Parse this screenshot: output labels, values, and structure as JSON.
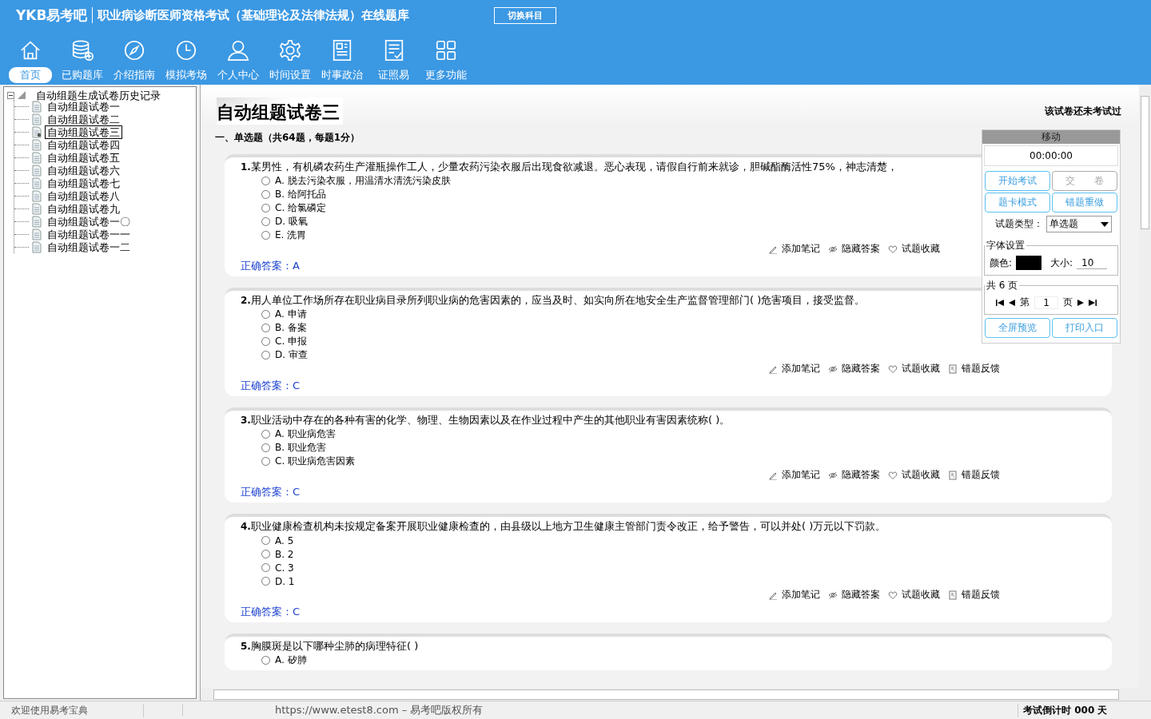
{
  "header": {
    "logo": "YKB易考吧",
    "title": "职业病诊断医师资格考试（基础理论及法律法规）在线题库",
    "switch_button": "切换科目"
  },
  "toolbar": [
    {
      "label": "首页",
      "selected": true
    },
    {
      "label": "已购题库",
      "selected": false
    },
    {
      "label": "介绍指南",
      "selected": false
    },
    {
      "label": "模拟考场",
      "selected": false
    },
    {
      "label": "个人中心",
      "selected": false
    },
    {
      "label": "时间设置",
      "selected": false
    },
    {
      "label": "时事政治",
      "selected": false
    },
    {
      "label": "证照易",
      "selected": false
    },
    {
      "label": "更多功能",
      "selected": false
    }
  ],
  "tree": {
    "label": "自动组题生成试卷历史记录",
    "expanded": true,
    "children": [
      {
        "label": "自动组题试卷一",
        "selected": false
      },
      {
        "label": "自动组题试卷二",
        "selected": false
      },
      {
        "label": "自动组题试卷三",
        "selected": true
      },
      {
        "label": "自动组题试卷四",
        "selected": false
      },
      {
        "label": "自动组题试卷五",
        "selected": false
      },
      {
        "label": "自动组题试卷六",
        "selected": false
      },
      {
        "label": "自动组题试卷七",
        "selected": false
      },
      {
        "label": "自动组题试卷八",
        "selected": false
      },
      {
        "label": "自动组题试卷九",
        "selected": false
      },
      {
        "label": "自动组题试卷一〇",
        "selected": false
      },
      {
        "label": "自动组题试卷一一",
        "selected": false
      },
      {
        "label": "自动组题试卷一二",
        "selected": false
      }
    ]
  },
  "paper": {
    "title": "自动组题试卷三",
    "status": "该试卷还未考试过",
    "section": "一、单选题（共64题，每题1分）"
  },
  "questions": [
    {
      "number": "1.",
      "text": "某男性，有机磷农药生产灌瓶操作工人，少量农药污染衣服后出现食欲减退。恶心表现，请假自行前来就诊，胆碱酯酶活性75%，神志清楚，",
      "options": [
        {
          "text": "A. 脱去污染衣服，用温清水清洗污染皮肤",
          "selected": false
        },
        {
          "text": "B. 给阿托品",
          "selected": false
        },
        {
          "text": "C. 给氯磷定",
          "selected": false
        },
        {
          "text": "D. 吸氧",
          "selected": false
        },
        {
          "text": "E. 洗胃",
          "selected": false
        }
      ],
      "actions": [
        "添加笔记",
        "隐藏答案",
        "试题收藏"
      ],
      "answer_label": "正确答案：",
      "answer": "A"
    },
    {
      "number": "2.",
      "text": "用人单位工作场所存在职业病目录所列职业病的危害因素的，应当及时、如实向所在地安全生产监督管理部门( )危害项目，接受监督。",
      "options": [
        {
          "text": "A. 申请",
          "selected": false
        },
        {
          "text": "B. 备案",
          "selected": false
        },
        {
          "text": "C. 申报",
          "selected": false
        },
        {
          "text": "D. 审查",
          "selected": false
        }
      ],
      "actions": [
        "添加笔记",
        "隐藏答案",
        "试题收藏",
        "错题反馈"
      ],
      "answer_label": "正确答案：",
      "answer": "C"
    },
    {
      "number": "3.",
      "text": "职业活动中存在的各种有害的化学、物理、生物因素以及在作业过程中产生的其他职业有害因素统称( )。",
      "options": [
        {
          "text": "A. 职业病危害",
          "selected": false
        },
        {
          "text": "B. 职业危害",
          "selected": false
        },
        {
          "text": "C. 职业病危害因素",
          "selected": false
        }
      ],
      "actions": [
        "添加笔记",
        "隐藏答案",
        "试题收藏",
        "错题反馈"
      ],
      "answer_label": "正确答案：",
      "answer": "C"
    },
    {
      "number": "4.",
      "text": "职业健康检查机构未按规定备案开展职业健康检查的，由县级以上地方卫生健康主管部门责令改正，给予警告，可以并处( )万元以下罚款。",
      "options": [
        {
          "text": "A. 5",
          "selected": false
        },
        {
          "text": "B. 2",
          "selected": false
        },
        {
          "text": "C. 3",
          "selected": false
        },
        {
          "text": "D. 1",
          "selected": false
        }
      ],
      "actions": [
        "添加笔记",
        "隐藏答案",
        "试题收藏",
        "错题反馈"
      ],
      "answer_label": "正确答案：",
      "answer": "C"
    },
    {
      "number": "5.",
      "text": "胸膜斑是以下哪种尘肺的病理特征( )",
      "options": [
        {
          "text": "A. 矽肺",
          "selected": false
        }
      ]
    }
  ],
  "panel": {
    "title": "移动",
    "timer": "00:00:00",
    "buttons": [
      {
        "label": "开始考试",
        "disabled": false
      },
      {
        "label": "交　　卷",
        "disabled": true
      },
      {
        "label": "题卡模式",
        "disabled": false
      },
      {
        "label": "错题重做",
        "disabled": false
      }
    ],
    "type_label": "试题类型：",
    "type_value": "单选题",
    "font_group": "字体设置",
    "color_label": "颜色:",
    "color": "#000000",
    "size_label": "大小:",
    "size_value": "10",
    "pages_group": "共 6 页",
    "page_prefix": "第",
    "page_value": "1",
    "page_suffix": "页",
    "bottom_buttons": [
      "全屏预览",
      "打印入口"
    ]
  },
  "status_bar": {
    "welcome": "欢迎使用易考宝典",
    "copyright": "https://www.etest8.com – 易考吧版权所有",
    "countdown": "考试倒计时 000 天"
  }
}
